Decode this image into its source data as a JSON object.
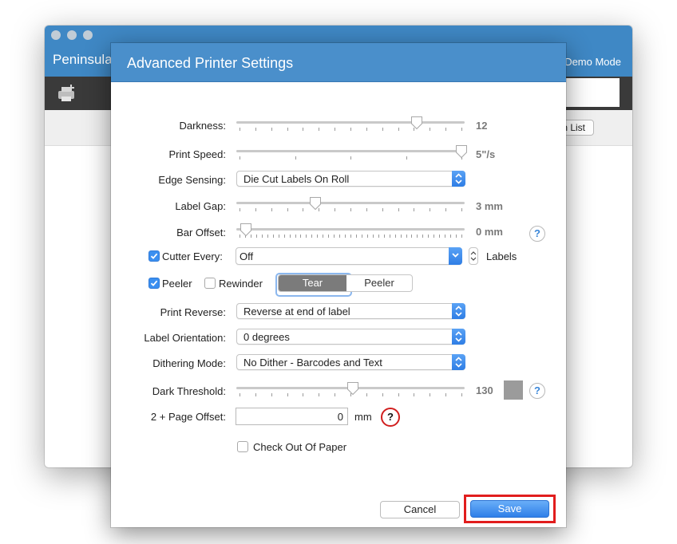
{
  "app": {
    "title": "Peninsula",
    "mode": "Demo Mode",
    "list_button": "n List"
  },
  "dialog": {
    "title": "Advanced Printer Settings",
    "darkness": {
      "label": "Darkness:",
      "value": "12",
      "level": 0.8
    },
    "print_speed": {
      "label": "Print Speed:",
      "value": "5\"/s",
      "level": 1.0
    },
    "edge_sensing": {
      "label": "Edge Sensing:",
      "selected": "Die Cut Labels On Roll"
    },
    "label_gap": {
      "label": "Label Gap:",
      "value": "3 mm",
      "level": 0.34
    },
    "bar_offset": {
      "label": "Bar Offset:",
      "value": "0 mm",
      "level": 0.03
    },
    "cutter_every": {
      "label": "Cutter Every:",
      "checked": true,
      "selected": "Off",
      "unit": "Labels"
    },
    "peeler_checkbox": {
      "label": "Peeler",
      "checked": true
    },
    "rewinder_checkbox": {
      "label": "Rewinder",
      "checked": false
    },
    "mode_segment": {
      "options": [
        "Tear",
        "Peeler"
      ],
      "selected": "Tear"
    },
    "print_reverse": {
      "label": "Print Reverse:",
      "selected": "Reverse at end of label"
    },
    "label_orientation": {
      "label": "Label Orientation:",
      "selected": "0 degrees"
    },
    "dithering_mode": {
      "label": "Dithering Mode:",
      "selected": "No Dither - Barcodes and Text"
    },
    "dark_threshold": {
      "label": "Dark Threshold:",
      "value": "130",
      "level": 0.51
    },
    "page_offset": {
      "label": "2 + Page Offset:",
      "value": "0",
      "unit": "mm"
    },
    "check_out_of_paper": {
      "label": "Check Out Of Paper",
      "checked": false
    },
    "help_text": "?",
    "cancel_label": "Cancel",
    "save_label": "Save"
  },
  "colors": {
    "header_blue": "#4a8fcb",
    "accent_blue": "#3b8ff0",
    "highlight_red": "#e11d1d",
    "swatch_gray": "#9b9b9b"
  }
}
